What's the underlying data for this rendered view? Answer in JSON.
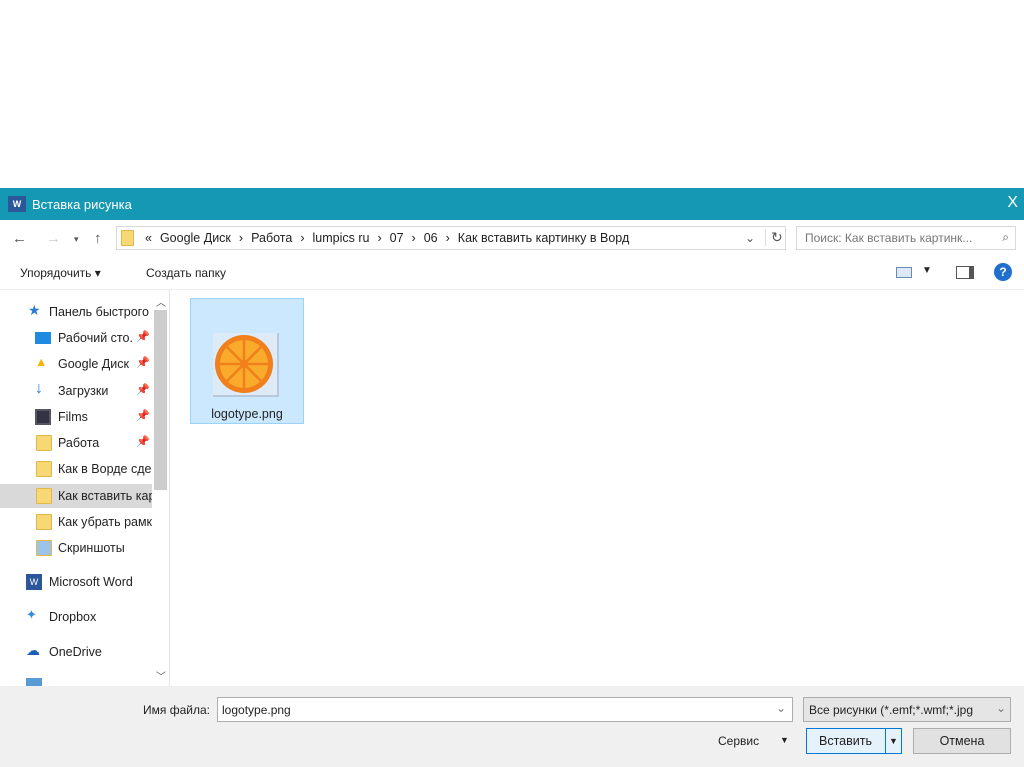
{
  "window": {
    "title": "Вставка рисунка",
    "close": "X"
  },
  "address": {
    "breadcrumbs": [
      "«",
      "Google Диск",
      "›",
      "Работа",
      "›",
      "lumpics ru",
      "›",
      "07",
      "›",
      "06",
      "›",
      "Как вставить картинку в Ворд"
    ],
    "search_placeholder": "Поиск: Как вставить картинк..."
  },
  "toolbar": {
    "organize": "Упорядочить ▾",
    "new_folder": "Создать папку"
  },
  "nav": {
    "items": [
      {
        "label": "Панель быстрого"
      },
      {
        "label": "Рабочий сто."
      },
      {
        "label": "Google Диск"
      },
      {
        "label": "Загрузки"
      },
      {
        "label": "Films"
      },
      {
        "label": "Работа"
      },
      {
        "label": "Как в Ворде сде"
      },
      {
        "label": "Как вставить кар"
      },
      {
        "label": "Как убрать рамк"
      },
      {
        "label": "Скриншоты"
      },
      {
        "label": "Microsoft Word"
      },
      {
        "label": "Dropbox"
      },
      {
        "label": "OneDrive"
      }
    ]
  },
  "files": [
    {
      "name": "logotype.png"
    }
  ],
  "bottom": {
    "filename_label": "Имя файла:",
    "filename_value": "logotype.png",
    "filter": "Все рисунки (*.emf;*.wmf;*.jpg",
    "tools": "Сервис",
    "insert": "Вставить",
    "cancel": "Отмена"
  }
}
